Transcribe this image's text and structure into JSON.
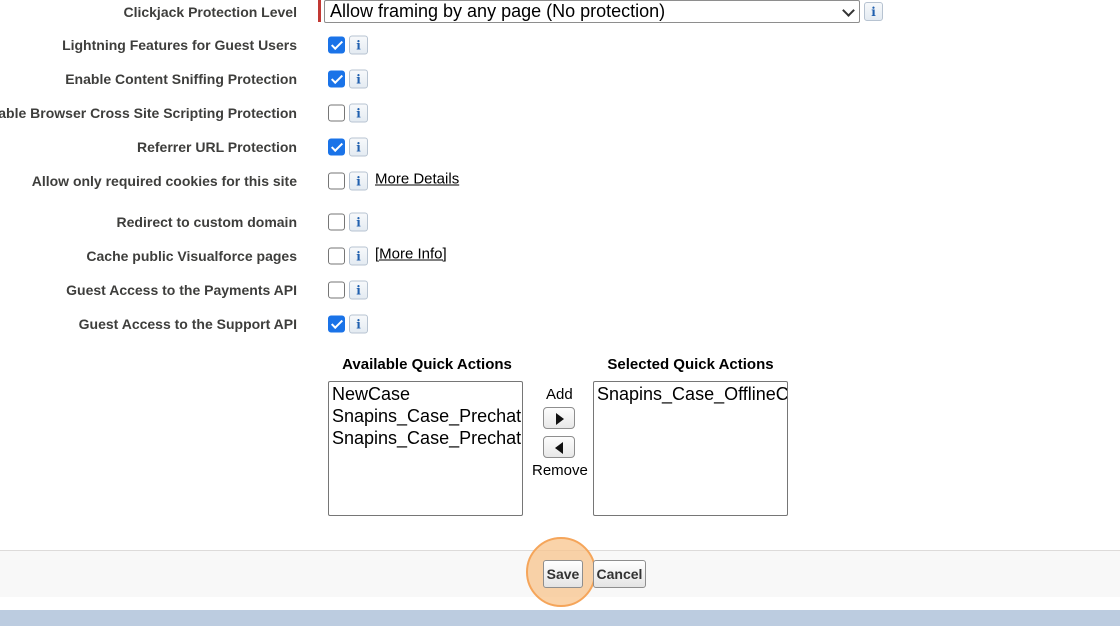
{
  "clickjack": {
    "label": "Clickjack Protection Level",
    "selected": "Allow framing by any page (No protection)"
  },
  "settings": [
    {
      "label": "Lightning Features for Guest Users",
      "checked": true,
      "link": ""
    },
    {
      "label": "Enable Content Sniffing Protection",
      "checked": true,
      "link": ""
    },
    {
      "label": "Enable Browser Cross Site Scripting Protection",
      "checked": false,
      "link": ""
    },
    {
      "label": "Referrer URL Protection",
      "checked": true,
      "link": ""
    },
    {
      "label": "Allow only required cookies for this site",
      "checked": false,
      "link": "More Details"
    },
    {
      "label": "Redirect to custom domain",
      "checked": false,
      "link": ""
    },
    {
      "label": "Cache public Visualforce pages",
      "checked": false,
      "link": "[More Info]"
    },
    {
      "label": "Guest Access to the Payments API",
      "checked": false,
      "link": ""
    },
    {
      "label": "Guest Access to the Support API",
      "checked": true,
      "link": ""
    }
  ],
  "info_glyph": "i",
  "quick_actions": {
    "available_title": "Available Quick Actions",
    "selected_title": "Selected Quick Actions",
    "available": [
      "NewCase",
      "Snapins_Case_PrechatC",
      "Snapins_Case_PrechatC"
    ],
    "selected": [
      "Snapins_Case_OfflineCa"
    ],
    "add_label": "Add",
    "remove_label": "Remove"
  },
  "buttons": {
    "save": "Save",
    "cancel": "Cancel"
  },
  "colors": {
    "checkbox_checked": "#1a73e8",
    "required_bar": "#c23934",
    "highlight": "#f8c48c"
  }
}
